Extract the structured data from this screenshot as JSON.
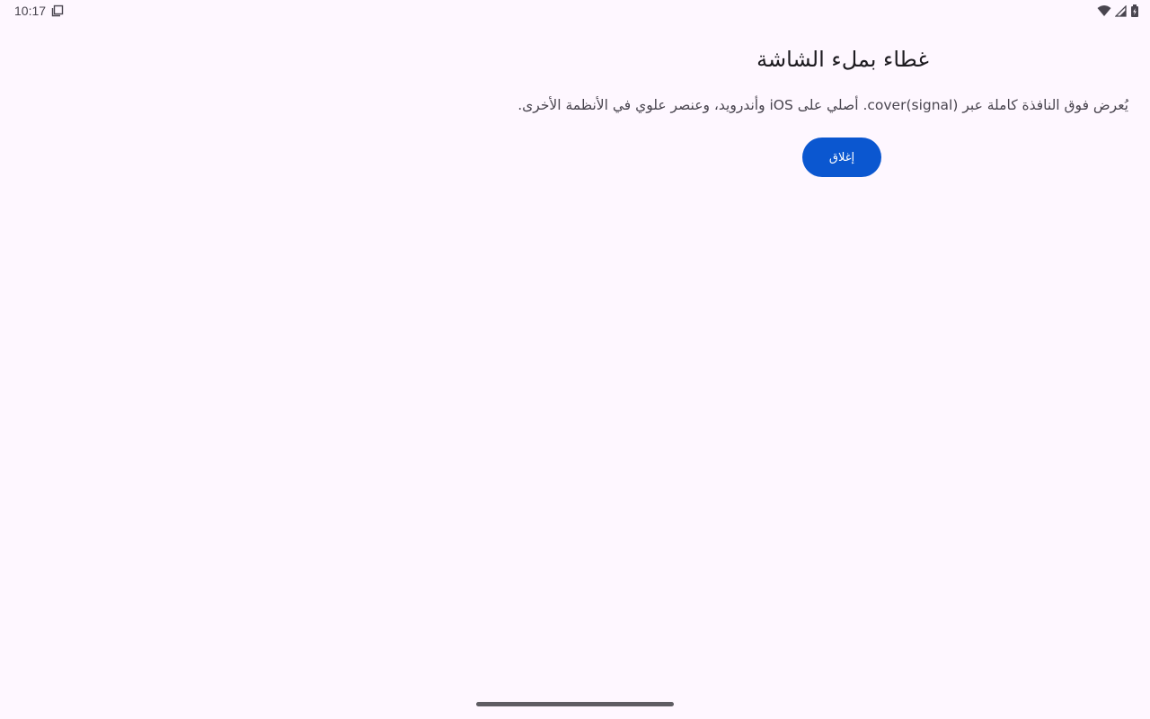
{
  "status_bar": {
    "time": "10:17",
    "icons": [
      "screenshot-icon",
      "wifi-icon",
      "signal-icon",
      "battery-charging-icon"
    ]
  },
  "dialog": {
    "title": "غطاء بملء الشاشة",
    "description": "يُعرض فوق النافذة كاملة عبر cover(signal). أصلي على iOS وأندرويد، وعنصر علوي في الأنظمة الأخرى.",
    "close_label": "إغلاق"
  },
  "colors": {
    "background": "#fef7ff",
    "primary_button": "#0b57d0",
    "text": "#1d1b20",
    "secondary_text": "#49454f"
  }
}
